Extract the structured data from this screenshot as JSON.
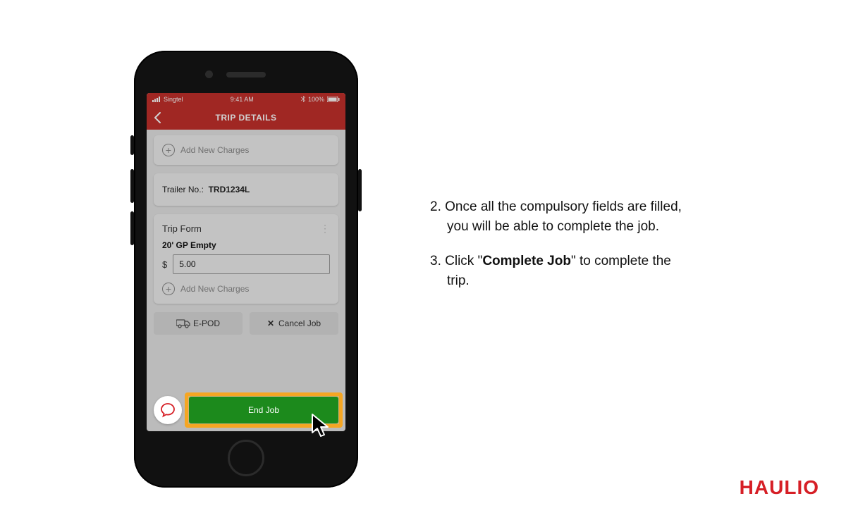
{
  "phone": {
    "status": {
      "carrier": "Singtel",
      "time": "9:41 AM",
      "battery": "100%"
    },
    "nav": {
      "title": "TRIP DETAILS"
    },
    "add_charges_top": "Add New Charges",
    "trailer": {
      "label": "Trailer No.:",
      "value": "TRD1234L"
    },
    "trip_form": {
      "title": "Trip Form",
      "type": "20' GP Empty",
      "currency": "$",
      "amount": "5.00",
      "add_charges": "Add New Charges"
    },
    "actions": {
      "epod": "E-POD",
      "cancel": "Cancel Job",
      "end": "End Job"
    }
  },
  "instructions": {
    "step2_a": "2. Once all the compulsory fields are filled,",
    "step2_b": "you will be able to complete the job.",
    "step3_a": "3. Click \"",
    "step3_bold": "Complete Job",
    "step3_b": "\" to complete the",
    "step3_c": "trip."
  },
  "brand": "HAULIO"
}
